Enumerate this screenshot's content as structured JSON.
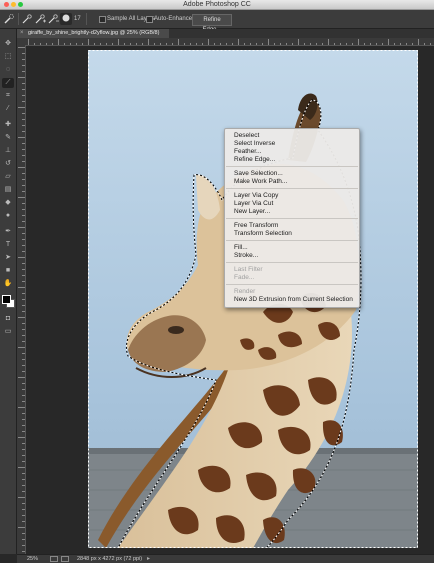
{
  "app": {
    "title": "Adobe Photoshop CC"
  },
  "options_bar": {
    "sample_all_layers_label": "Sample All Layers",
    "auto_enhance_label": "Auto-Enhance",
    "refine_edge_label": "Refine Edge...",
    "brush_size": "17"
  },
  "document": {
    "tab_title": "giraffe_by_shine_brightly-d2yflow.jpg @ 25% (RGB/8)",
    "close_glyph": "×"
  },
  "context_menu": {
    "items": [
      {
        "label": "Deselect",
        "enabled": true
      },
      {
        "label": "Select Inverse",
        "enabled": true
      },
      {
        "label": "Feather...",
        "enabled": true
      },
      {
        "label": "Refine Edge...",
        "enabled": true
      },
      {
        "label": "Save Selection...",
        "enabled": true
      },
      {
        "label": "Make Work Path...",
        "enabled": true
      },
      {
        "label": "Layer Via Copy",
        "enabled": true
      },
      {
        "label": "Layer Via Cut",
        "enabled": true
      },
      {
        "label": "New Layer...",
        "enabled": true
      },
      {
        "label": "Free Transform",
        "enabled": true
      },
      {
        "label": "Transform Selection",
        "enabled": true
      },
      {
        "label": "Fill...",
        "enabled": true
      },
      {
        "label": "Stroke...",
        "enabled": true
      },
      {
        "label": "Last Filter",
        "enabled": false
      },
      {
        "label": "Fade...",
        "enabled": false
      },
      {
        "label": "Render",
        "enabled": false
      },
      {
        "label": "New 3D Extrusion from Current Selection",
        "enabled": true
      }
    ]
  },
  "status_bar": {
    "zoom": "25%",
    "doc_info": "2848 px x 4272 px (72 ppi)"
  },
  "colors": {
    "foreground": "#000000",
    "background": "#ffffff",
    "sky": "#a9c5de",
    "giraffe_patch": "#6b3a1c"
  },
  "icons": [
    "move-icon",
    "marquee-icon",
    "lasso-icon",
    "quick-selection-icon",
    "crop-icon",
    "eyedropper-icon",
    "healing-icon",
    "brush-icon",
    "clone-stamp-icon",
    "history-brush-icon",
    "eraser-icon",
    "gradient-icon",
    "blur-icon",
    "dodge-icon",
    "pen-icon",
    "type-icon",
    "path-selection-icon",
    "shape-icon",
    "hand-icon",
    "zoom-icon"
  ]
}
